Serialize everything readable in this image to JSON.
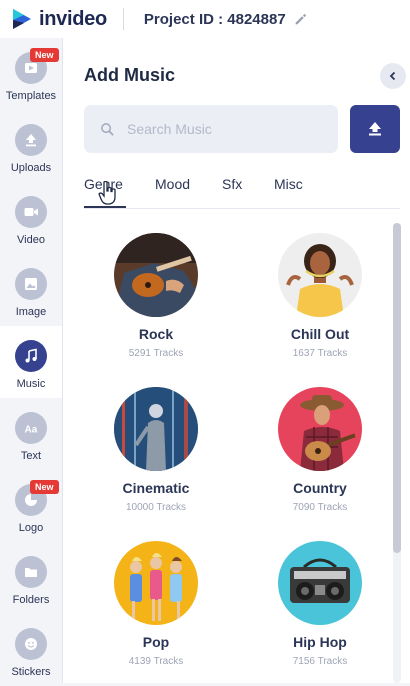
{
  "topbar": {
    "brand": "invideo",
    "project_label": "Project ID : 4824887",
    "icons": {
      "logo": "invideo-logo-icon",
      "edit": "pencil-icon"
    }
  },
  "sidebar": {
    "items": [
      {
        "label": "Templates",
        "icon": "templates-icon",
        "badge": "New",
        "active": false
      },
      {
        "label": "Uploads",
        "icon": "upload-icon",
        "active": false
      },
      {
        "label": "Video",
        "icon": "video-camera-icon",
        "active": false
      },
      {
        "label": "Image",
        "icon": "image-icon",
        "active": false
      },
      {
        "label": "Music",
        "icon": "music-note-icon",
        "active": true
      },
      {
        "label": "Text",
        "icon": "text-aa-icon",
        "active": false
      },
      {
        "label": "Logo",
        "icon": "logo-icon",
        "badge": "New",
        "active": false
      },
      {
        "label": "Folders",
        "icon": "folder-icon",
        "active": false
      },
      {
        "label": "Stickers",
        "icon": "sticker-icon",
        "active": false
      }
    ]
  },
  "panel": {
    "title": "Add Music",
    "search_placeholder": "Search Music",
    "tabs": [
      {
        "label": "Genre",
        "active": true
      },
      {
        "label": "Mood",
        "active": false
      },
      {
        "label": "Sfx",
        "active": false
      },
      {
        "label": "Misc",
        "active": false
      }
    ],
    "genres": [
      {
        "name": "Rock",
        "count": "5291 Tracks"
      },
      {
        "name": "Chill Out",
        "count": "1637 Tracks"
      },
      {
        "name": "Cinematic",
        "count": "10000 Tracks"
      },
      {
        "name": "Country",
        "count": "7090 Tracks"
      },
      {
        "name": "Pop",
        "count": "4139 Tracks"
      },
      {
        "name": "Hip Hop",
        "count": "7156 Tracks"
      }
    ]
  },
  "colors": {
    "accent": "#36418f",
    "badge": "#e53935",
    "text": "#2b3556",
    "muted": "#9ea4b6"
  }
}
